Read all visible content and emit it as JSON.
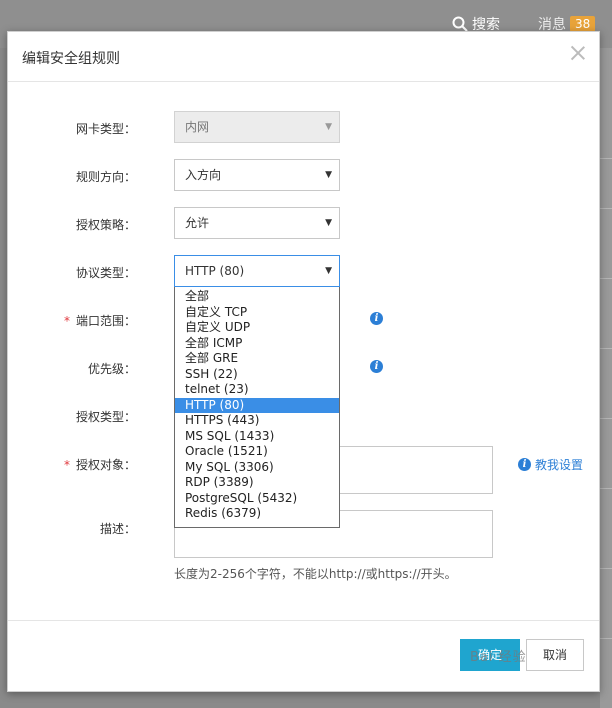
{
  "topbar": {
    "search_label": "搜索",
    "messages_label": "消息",
    "messages_count": "38"
  },
  "dialog": {
    "title": "编辑安全组规则"
  },
  "form": {
    "nic_type": {
      "label": "网卡类型：",
      "value": "内网"
    },
    "direction": {
      "label": "规则方向：",
      "value": "入方向"
    },
    "policy": {
      "label": "授权策略：",
      "value": "允许"
    },
    "protocol": {
      "label": "协议类型：",
      "value": "HTTP (80)",
      "options": [
        "全部",
        "自定义 TCP",
        "自定义 UDP",
        "全部 ICMP",
        "全部 GRE",
        "SSH (22)",
        "telnet (23)",
        "HTTP (80)",
        "HTTPS (443)",
        "MS SQL (1433)",
        "Oracle (1521)",
        "My SQL (3306)",
        "RDP (3389)",
        "PostgreSQL (5432)",
        "Redis (6379)"
      ],
      "selected_index": 7
    },
    "port_range": {
      "label": "端口范围：",
      "required_mark": "*"
    },
    "priority": {
      "label": "优先级："
    },
    "auth_type": {
      "label": "授权类型："
    },
    "auth_object": {
      "label": "授权对象：",
      "required_mark": "*",
      "help_link": "教我设置"
    },
    "description": {
      "label": "描述：",
      "hint": "长度为2-256个字符，不能以http://或https://开头。"
    }
  },
  "footer": {
    "ok_label": "确定",
    "cancel_label": "取消"
  },
  "watermark": "Bai 经验",
  "colors": {
    "primary": "#1fa5cf",
    "selected": "#3a8ee6",
    "link": "#2c7fd6",
    "required": "#e0393e"
  }
}
